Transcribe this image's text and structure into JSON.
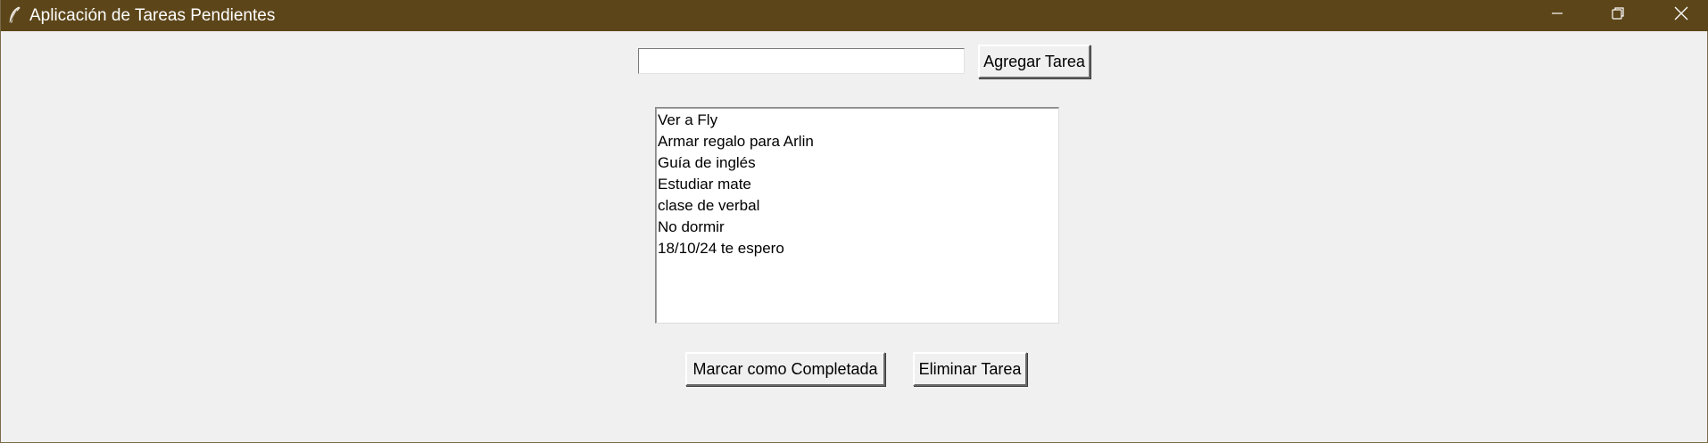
{
  "window": {
    "title": "Aplicación de Tareas Pendientes",
    "icon": "feather-icon",
    "controls": [
      "minimize-icon",
      "restore-icon",
      "close-icon"
    ]
  },
  "input": {
    "value": "",
    "placeholder": ""
  },
  "buttons": {
    "add": "Agregar Tarea",
    "complete": "Marcar como Completada",
    "delete": "Eliminar Tarea"
  },
  "tasks": [
    "Ver a Fly",
    "Armar regalo para Arlin",
    "Guía de inglés",
    "Estudiar mate",
    "clase de verbal",
    "No dormir",
    "18/10/24 te espero"
  ],
  "colors": {
    "titlebar": "#5c4519",
    "background": "#f0f0f0"
  }
}
